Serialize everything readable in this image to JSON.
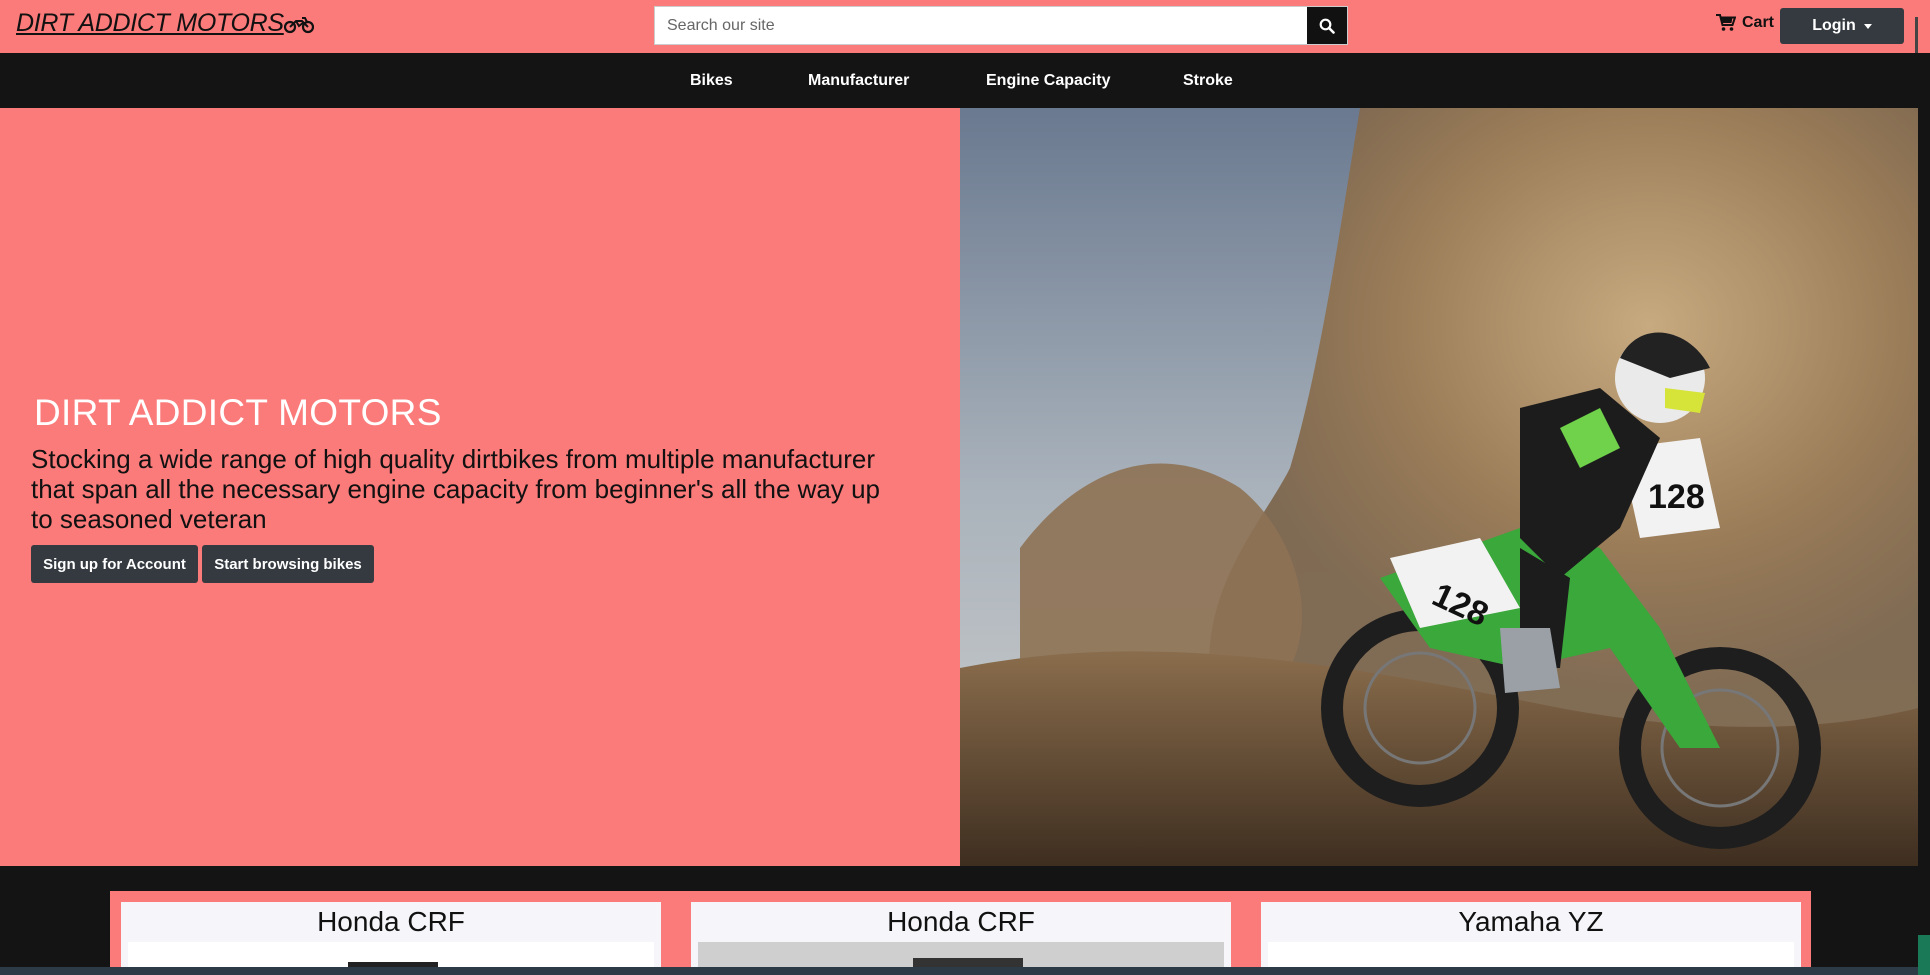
{
  "header": {
    "brand": "DIRT ADDICT MOTORS",
    "search_placeholder": "Search our site",
    "cart_label": "Cart",
    "login_label": "Login"
  },
  "nav": {
    "items": [
      {
        "label": "Bikes"
      },
      {
        "label": "Manufacturer"
      },
      {
        "label": "Engine Capacity"
      },
      {
        "label": "Stroke"
      }
    ]
  },
  "hero": {
    "title": "DIRT ADDICT MOTORS",
    "text": "Stocking a wide range of high quality dirtbikes from multiple manufacturer that span all the necessary engine capacity from beginner's all the way up to seasoned veteran",
    "signup_label": "Sign up for Account",
    "browse_label": "Start browsing bikes",
    "image_number": "128"
  },
  "products": [
    {
      "title": "Honda CRF"
    },
    {
      "title": "Honda CRF"
    },
    {
      "title": "Yamaha YZ"
    }
  ],
  "colors": {
    "brand_pink": "#fb7a7a",
    "dark": "#141414",
    "button_dark": "#343a40"
  }
}
